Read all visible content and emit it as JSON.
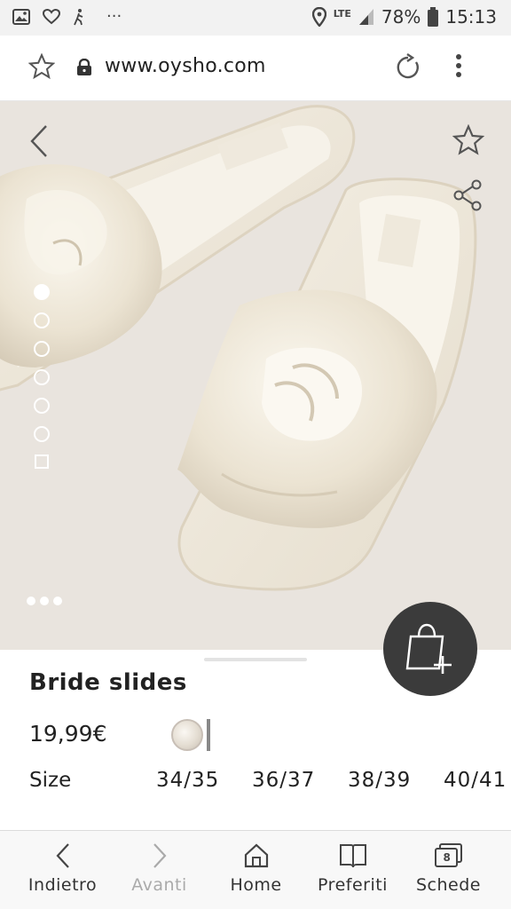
{
  "status_bar": {
    "network": "LTE",
    "battery": "78%",
    "time": "15:13",
    "more_dots": "···"
  },
  "browser": {
    "url": "www.oysho.com"
  },
  "hero": {
    "image_count": 7,
    "active_index": 0
  },
  "product": {
    "name": "Bride slides",
    "price": "19,99€",
    "size_label": "Size",
    "sizes": [
      "34/35",
      "36/37",
      "38/39",
      "40/41"
    ]
  },
  "bottom_nav": {
    "back": "Indietro",
    "forward": "Avanti",
    "home": "Home",
    "bookmarks": "Preferiti",
    "tabs": "Schede",
    "tab_count": "8"
  },
  "colors": {
    "hero_bg": "#e9e4de",
    "fab": "#3b3b3b",
    "text": "#222222"
  }
}
